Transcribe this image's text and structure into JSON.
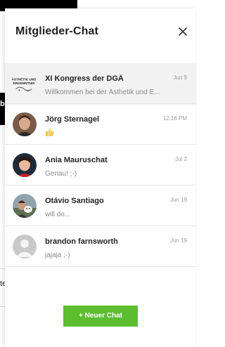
{
  "header": {
    "title": "Mitglieder-Chat",
    "close_icon": "close-icon"
  },
  "chats": [
    {
      "name": "XI Kongress der DGÄ",
      "date": "Jun 9",
      "preview": "Willkommen bei der Ästhetik und E...",
      "avatar": "congress-logo",
      "avatar_text": "ÄSTHETIK UND ERKENNTNIS"
    },
    {
      "name": "Jörg Sternagel",
      "date": "12:16 PM",
      "preview": "",
      "preview_icon": "thumbs-up-icon",
      "avatar": "photo"
    },
    {
      "name": "Ania Mauruschat",
      "date": "Jul 2",
      "preview": "Genau! ;-)",
      "avatar": "photo"
    },
    {
      "name": "Otávio Santiago",
      "date": "Jun 19",
      "preview": "will do...",
      "avatar": "photo"
    },
    {
      "name": "brandon farnsworth",
      "date": "Jun 19",
      "preview": "jajaja ;-)",
      "avatar": "default-user-icon"
    }
  ],
  "footer": {
    "new_chat_label": "+ Neuer Chat"
  },
  "colors": {
    "accent": "#5cbd2e",
    "active_row": "#f2f2f2"
  }
}
